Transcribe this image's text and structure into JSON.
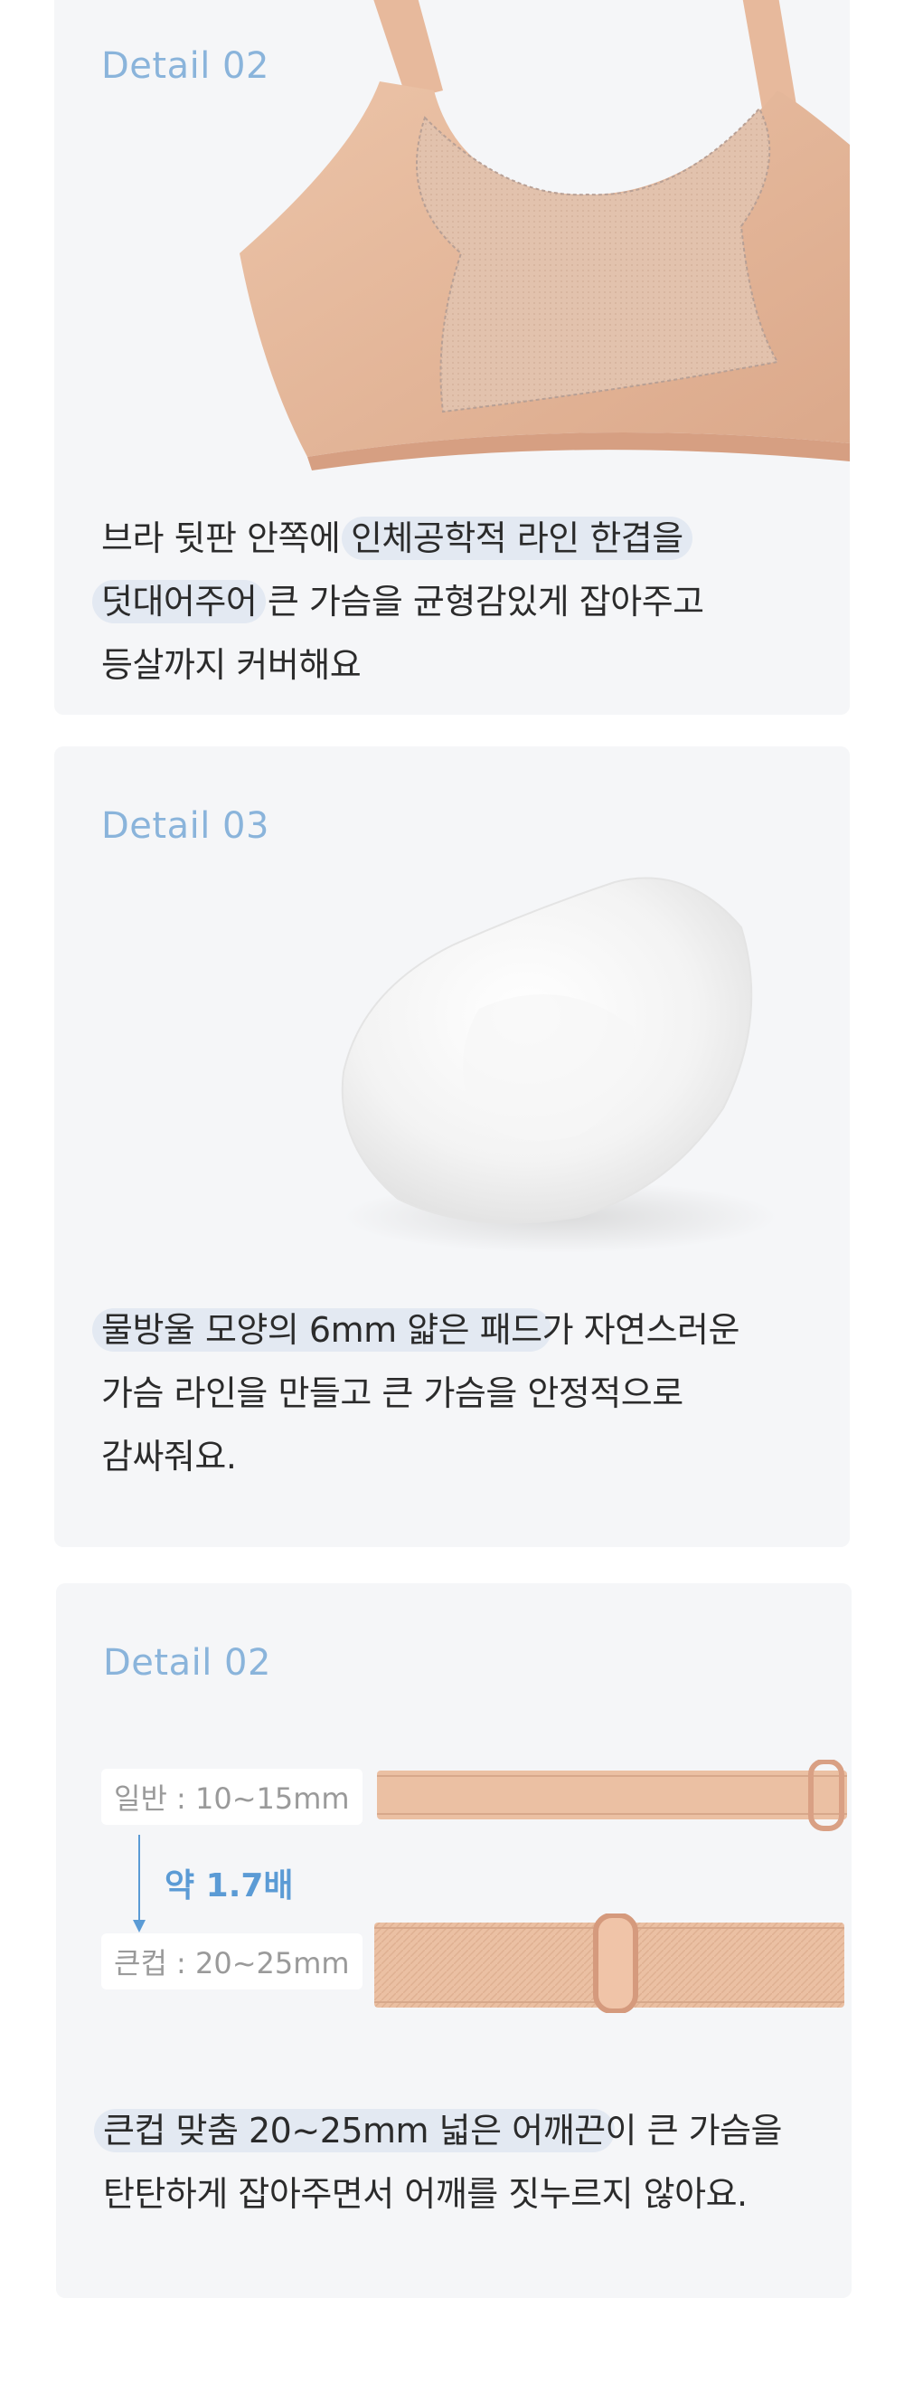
{
  "sections": [
    {
      "label": "Detail 02",
      "desc": {
        "line1_plain": "브라 뒷판 안쪽에 ",
        "line1_hl": "인체공학적 라인 한겹을",
        "line2_hl": "덧대어주어",
        "line2_plain": " 큰 가슴을 균형감있게 잡아주고",
        "line3": "등살까지 커버해요"
      }
    },
    {
      "label": "Detail 03",
      "desc": {
        "line1_hl": "물방울 모양의 6mm 얇은 패드",
        "line1_plain": "가 자연스러운",
        "line2": "가슴 라인을 만들고 큰 가슴을 안정적으로",
        "line3": "감싸줘요."
      }
    },
    {
      "label": "Detail 02",
      "normal_tag": "일반 : 10~15mm",
      "bigcup_tag": "큰컵 : 20~25mm",
      "ratio": "약 1.7배",
      "desc": {
        "line1_hl": "큰컵 맞춤 20~25mm 넓은 어깨끈",
        "line1_plain": "이 큰 가슴을",
        "line2": "탄탄하게 잡아주면서 어깨를 짓누르지 않아요."
      }
    }
  ],
  "colors": {
    "card_bg": "#f5f6f8",
    "accent": "#8ab4db",
    "highlight": "#e3e9f2",
    "fabric": "#e9bfa4"
  }
}
